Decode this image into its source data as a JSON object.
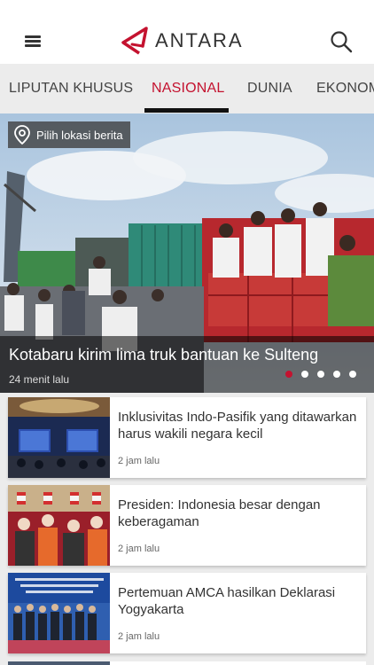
{
  "header": {
    "menu_icon": "hamburger-menu-icon",
    "logo_text": "ANTARA",
    "search_icon": "search-icon",
    "brand_color": "#c4122f"
  },
  "tabs": [
    {
      "label": "LIPUTAN KHUSUS",
      "active": false
    },
    {
      "label": "NASIONAL",
      "active": true
    },
    {
      "label": "DUNIA",
      "active": false
    },
    {
      "label": "EKONOMI",
      "active": false
    }
  ],
  "hero": {
    "location_button": "Pilih lokasi berita",
    "location_icon": "location-pin-icon",
    "title": "Kotabaru kirim lima truk bantuan ke Sulteng",
    "time": "24 menit lalu",
    "slides_total": 5,
    "slide_active": 1
  },
  "articles": [
    {
      "title": "Inklusivitas Indo-Pasifik yang ditawarkan harus wakili negara kecil",
      "time": "2 jam lalu"
    },
    {
      "title": "Presiden: Indonesia besar dengan keberagaman",
      "time": "2 jam lalu"
    },
    {
      "title": "Pertemuan AMCA hasilkan Deklarasi Yogyakarta",
      "time": "2 jam lalu"
    }
  ]
}
